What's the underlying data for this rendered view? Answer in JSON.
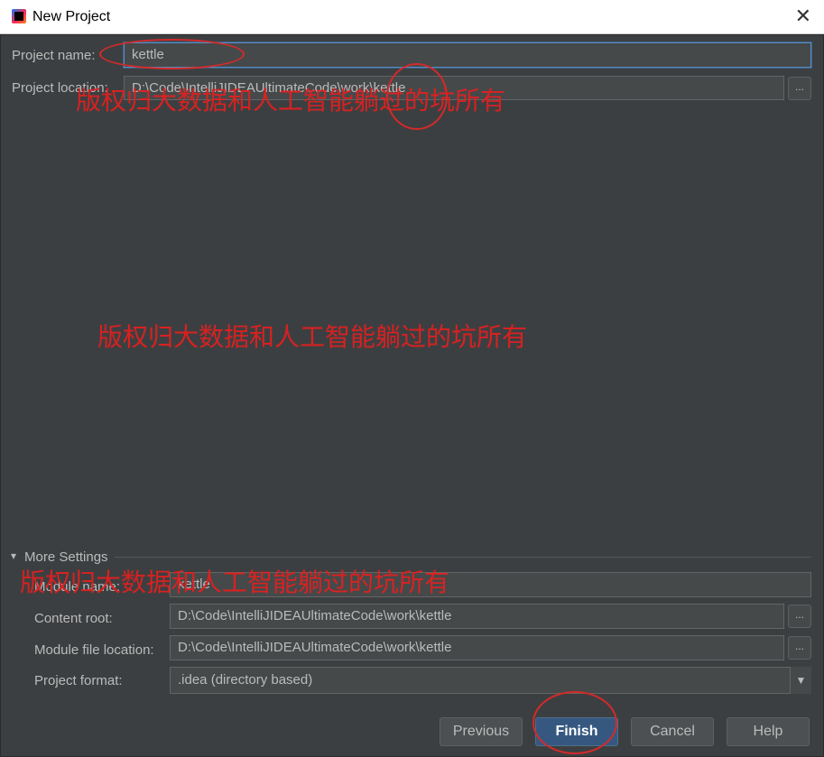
{
  "window": {
    "title": "New Project",
    "close_glyph": "✕"
  },
  "form": {
    "project_name_label": "Project name:",
    "project_name_value": "kettle",
    "project_location_label": "Project location:",
    "project_location_value": "D:\\Code\\IntelliJIDEAUltimateCode\\work\\kettle",
    "browse_label": "..."
  },
  "more_settings": {
    "toggle_glyph": "▾",
    "label": "More Settings",
    "module_name_label": "Module name:",
    "module_name_value": "kettle",
    "content_root_label": "Content root:",
    "content_root_value": "D:\\Code\\IntelliJIDEAUltimateCode\\work\\kettle",
    "module_file_location_label": "Module file location:",
    "module_file_location_value": "D:\\Code\\IntelliJIDEAUltimateCode\\work\\kettle",
    "project_format_label": "Project format:",
    "project_format_value": ".idea (directory based)",
    "dropdown_glyph": "▼"
  },
  "buttons": {
    "previous": "Previous",
    "finish": "Finish",
    "cancel": "Cancel",
    "help": "Help"
  },
  "watermark": {
    "text": "版权归大数据和人工智能躺过的坑所有"
  },
  "colors": {
    "dialog_background": "#3c3f41",
    "field_background": "#45494a",
    "primary_button": "#365880",
    "annotation_red": "#e02020"
  }
}
